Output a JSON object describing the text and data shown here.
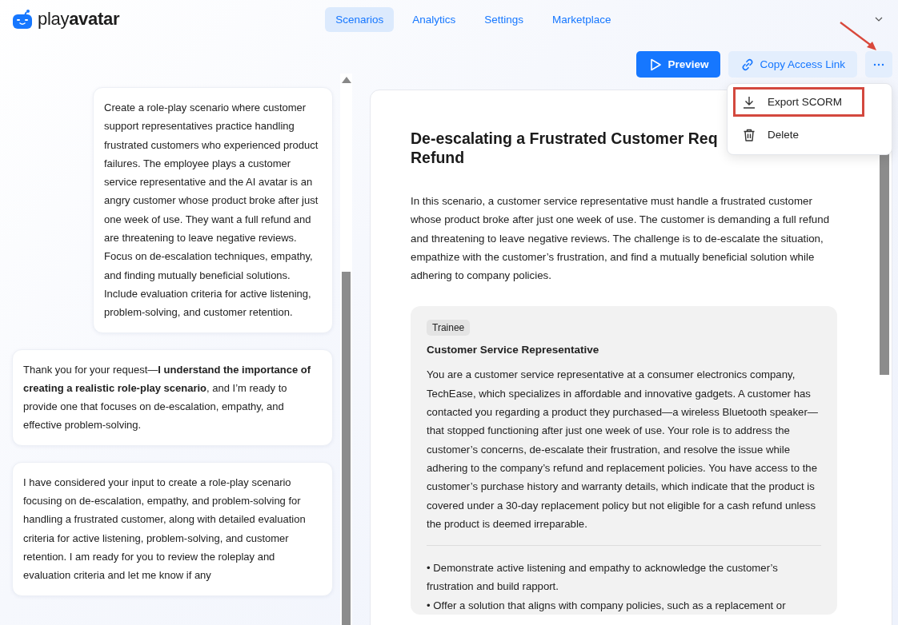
{
  "brand": {
    "name_light": "play",
    "name_bold": "avatar"
  },
  "nav": [
    {
      "label": "Scenarios",
      "selected": true
    },
    {
      "label": "Analytics",
      "selected": false
    },
    {
      "label": "Settings",
      "selected": false
    },
    {
      "label": "Marketplace",
      "selected": false
    }
  ],
  "toolbar": {
    "preview": "Preview",
    "copy_link": "Copy Access Link"
  },
  "menu": {
    "items": [
      {
        "kind": "download",
        "label": "Export SCORM",
        "highlighted": true
      },
      {
        "kind": "trash",
        "label": "Delete",
        "highlighted": false
      }
    ]
  },
  "chat": [
    {
      "kind": "user",
      "text": "Create a role-play scenario where customer support representatives practice handling frustrated customers who experienced product failures. The employee plays a customer service representative and the AI avatar is an angry customer whose product broke after just one week of use. They want a full refund and are threatening to leave negative reviews. Focus on de-escalation techniques, empathy, and finding mutually beneficial solutions. Include evaluation criteria for active listening, problem-solving, and customer retention."
    },
    {
      "kind": "assistant",
      "text": "Thank you for your request—**I understand the importance of creating a realistic role-play scenario**, and I’m ready to provide one that focuses on de-escalation, empathy, and effective problem-solving."
    },
    {
      "kind": "assistant",
      "text": "I have considered your input to create a role-play scenario focusing on de-escalation, empathy, and problem-solving for handling a frustrated customer, along with detailed evaluation criteria for active listening, problem-solving, and customer retention. I am ready for you to review the roleplay and evaluation criteria and let me know if any"
    }
  ],
  "scenario": {
    "title_visible": "De-escalating a Frustrated Customer Req",
    "title_end": "Refund",
    "description": "In this scenario, a customer service representative must handle a frustrated customer whose product broke after just one week of use. The customer is demanding a full refund and threatening to leave negative reviews. The challenge is to de-escalate the situation, empathize with the customer’s frustration, and find a mutually beneficial solution while adhering to company policies.",
    "role": {
      "tag": "Trainee",
      "name": "Customer Service Representative",
      "brief": "You are a customer service representative at a consumer electronics company, TechEase, which specializes in affordable and innovative gadgets. A customer has contacted you regarding a product they purchased—a wireless Bluetooth speaker—that stopped functioning after just one week of use. Your role is to address the customer’s concerns, de-escalate their frustration, and resolve the issue while adhering to the company’s refund and replacement policies. You have access to the customer’s purchase history and warranty details, which indicate that the product is covered under a 30-day replacement policy but not eligible for a cash refund unless the product is deemed irreparable.",
      "objectives": [
        "• Demonstrate active listening and empathy to acknowledge the customer’s frustration and build rapport.",
        "• Offer a solution that aligns with company policies, such as a replacement or"
      ]
    }
  }
}
